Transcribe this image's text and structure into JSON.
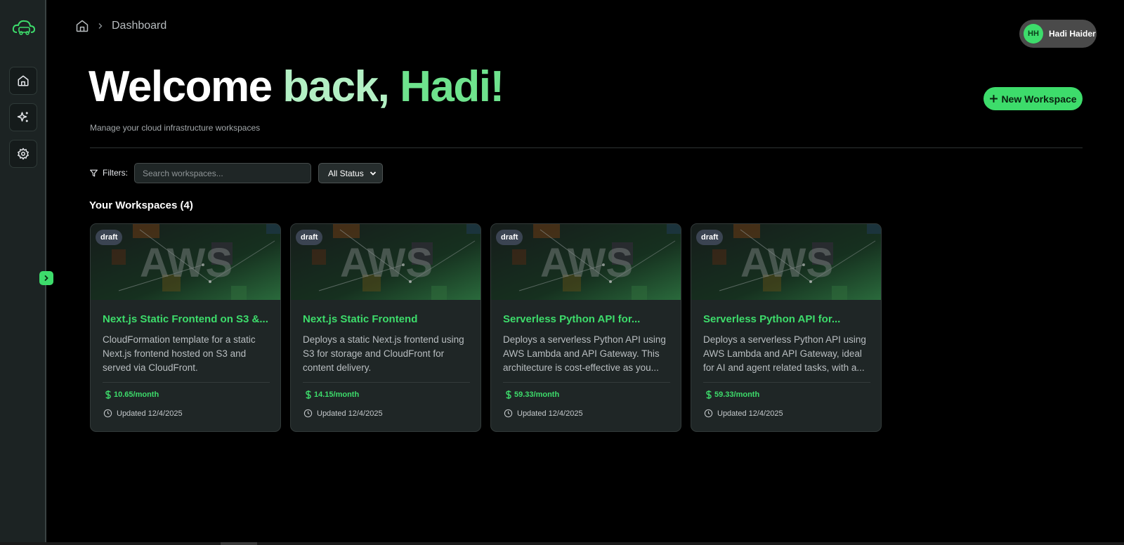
{
  "colors": {
    "accent": "#3ddc6b",
    "background": "#000000",
    "sidebar": "#1c2323",
    "card": "#1f2626"
  },
  "sidebar": {
    "logo_icon": "cloud-car-logo",
    "items": [
      {
        "icon": "home-icon"
      },
      {
        "icon": "sparkles-icon"
      },
      {
        "icon": "gear-icon"
      }
    ],
    "expand_icon": "chevron-right-icon"
  },
  "breadcrumb": {
    "home_icon": "home-icon",
    "current": "Dashboard"
  },
  "user": {
    "initials": "HH",
    "name": "Hadi Haider"
  },
  "header": {
    "welcome_part1": "Welcome",
    "welcome_part2": "back,",
    "welcome_part3": "Hadi!",
    "subtitle": "Manage your cloud infrastructure workspaces",
    "new_workspace_label": "New Workspace"
  },
  "filters": {
    "label": "Filters:",
    "search_placeholder": "Search workspaces...",
    "status_selected": "All Status"
  },
  "workspaces": {
    "title": "Your Workspaces (4)",
    "banner_text": "AWS",
    "cards": [
      {
        "badge": "draft",
        "title": "Next.js Static Frontend on S3 &...",
        "description": "CloudFormation template for a static Next.js frontend hosted on S3 and served via CloudFront.",
        "price": "10.65/month",
        "updated": "Updated 12/4/2025"
      },
      {
        "badge": "draft",
        "title": "Next.js Static Frontend",
        "description": "Deploys a static Next.js frontend using S3 for storage and CloudFront for content delivery.",
        "price": "14.15/month",
        "updated": "Updated 12/4/2025"
      },
      {
        "badge": "draft",
        "title": "Serverless Python API for...",
        "description": "Deploys a serverless Python API using AWS Lambda and API Gateway. This architecture is cost-effective as you...",
        "price": "59.33/month",
        "updated": "Updated 12/4/2025"
      },
      {
        "badge": "draft",
        "title": "Serverless Python API for...",
        "description": "Deploys a serverless Python API using AWS Lambda and API Gateway, ideal for AI and agent related tasks, with a...",
        "price": "59.33/month",
        "updated": "Updated 12/4/2025"
      }
    ]
  }
}
